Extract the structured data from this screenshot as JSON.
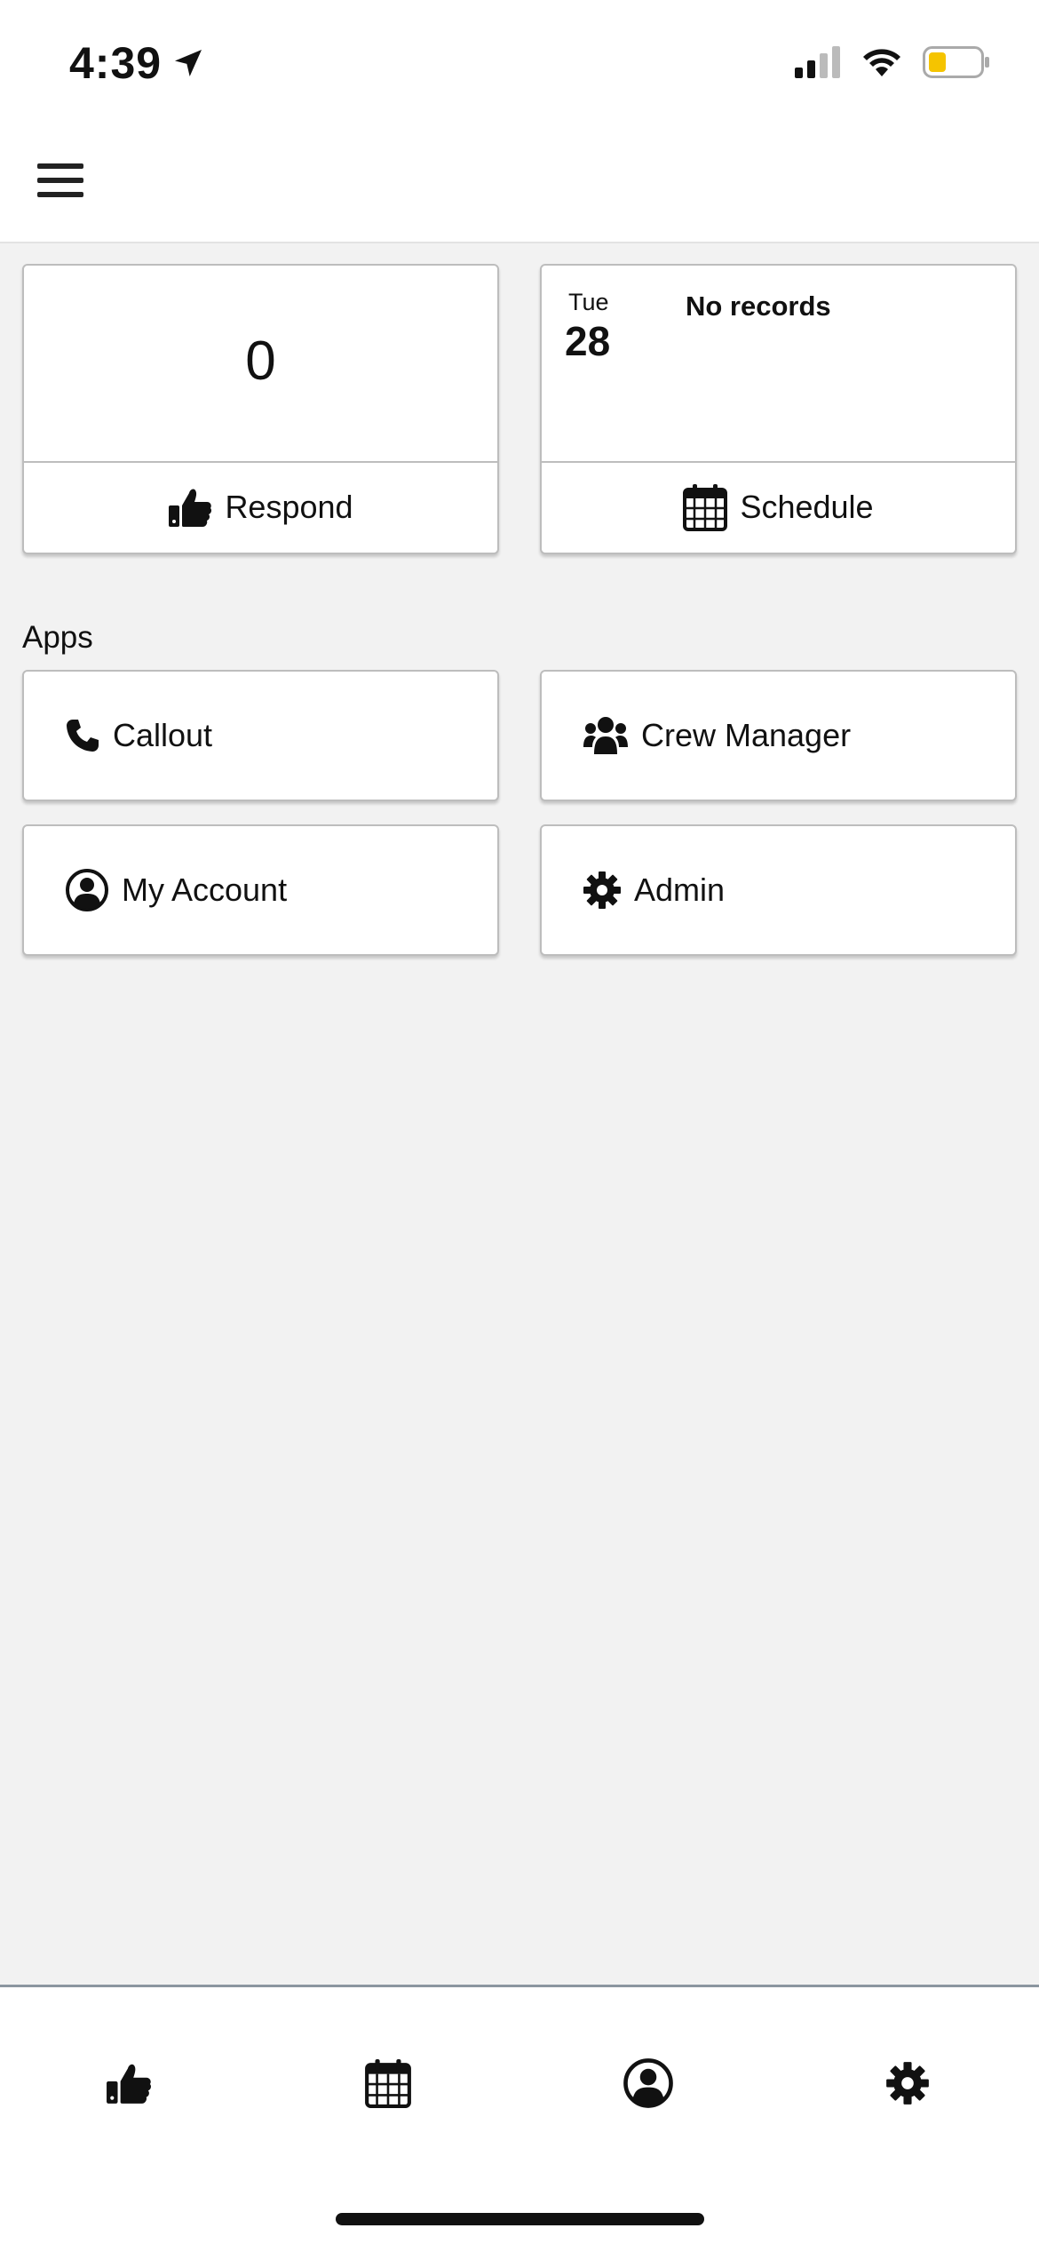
{
  "status_bar": {
    "time": "4:39"
  },
  "header": {
    "menu_icon": "hamburger-icon"
  },
  "respond_tile": {
    "count": "0",
    "label": "Respond",
    "icon": "thumbs-up-icon"
  },
  "schedule_tile": {
    "day_name": "Tue",
    "day_number": "28",
    "message": "No records",
    "label": "Schedule",
    "icon": "calendar-icon"
  },
  "apps": {
    "title": "Apps",
    "items": [
      {
        "label": "Callout",
        "icon": "phone-icon"
      },
      {
        "label": "Crew Manager",
        "icon": "users-icon"
      },
      {
        "label": "My Account",
        "icon": "user-circle-icon"
      },
      {
        "label": "Admin",
        "icon": "gear-icon"
      }
    ]
  },
  "bottom_nav": {
    "items": [
      {
        "icon": "thumbs-up-icon"
      },
      {
        "icon": "calendar-icon"
      },
      {
        "icon": "user-circle-icon"
      },
      {
        "icon": "gear-icon"
      }
    ]
  },
  "colors": {
    "background": "#f2f2f2",
    "battery_fill": "#f5c400",
    "text": "#111111"
  }
}
